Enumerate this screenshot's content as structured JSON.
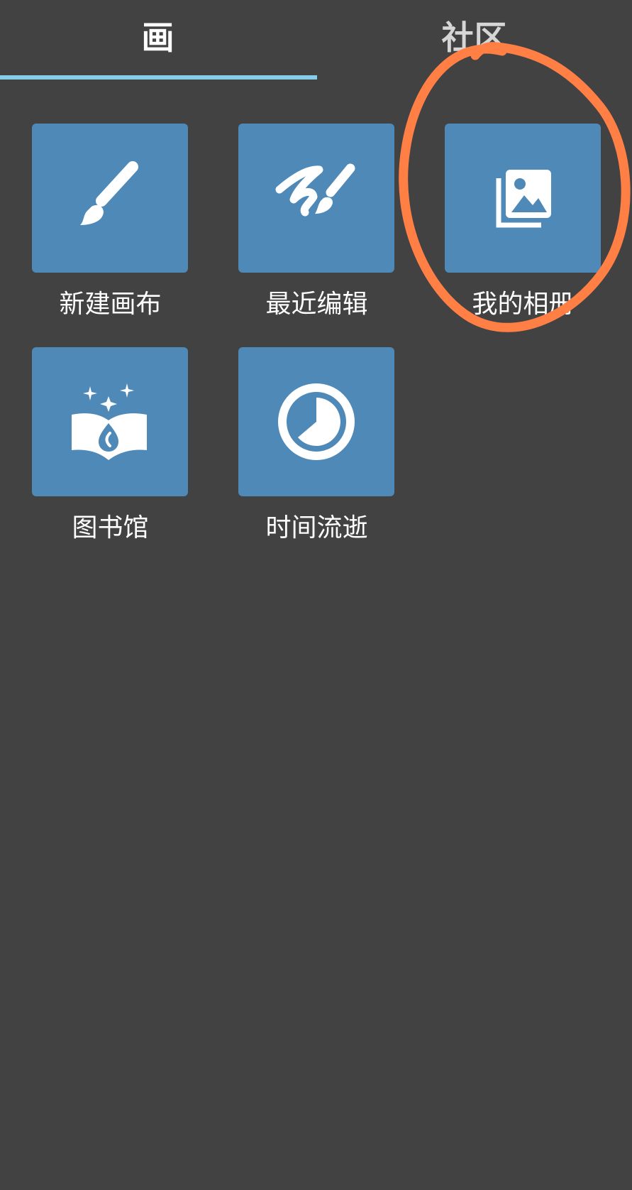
{
  "tabs": {
    "draw_label": "画",
    "community_label": "社区",
    "active_tab": "画"
  },
  "tiles": [
    {
      "label": "新建画布",
      "icon": "brush-icon"
    },
    {
      "label": "最近编辑",
      "icon": "recent-edit-icon"
    },
    {
      "label": "我的相册",
      "icon": "gallery-icon"
    },
    {
      "label": "图书馆",
      "icon": "library-icon"
    },
    {
      "label": "时间流逝",
      "icon": "timelapse-icon"
    }
  ],
  "annotation": {
    "type": "hand-drawn-circle",
    "target": "我的相册",
    "color": "#ff7f45"
  },
  "colors": {
    "background": "#424242",
    "tile": "#4e89b7",
    "tab_indicator": "#86cdea",
    "text": "#ffffff"
  }
}
